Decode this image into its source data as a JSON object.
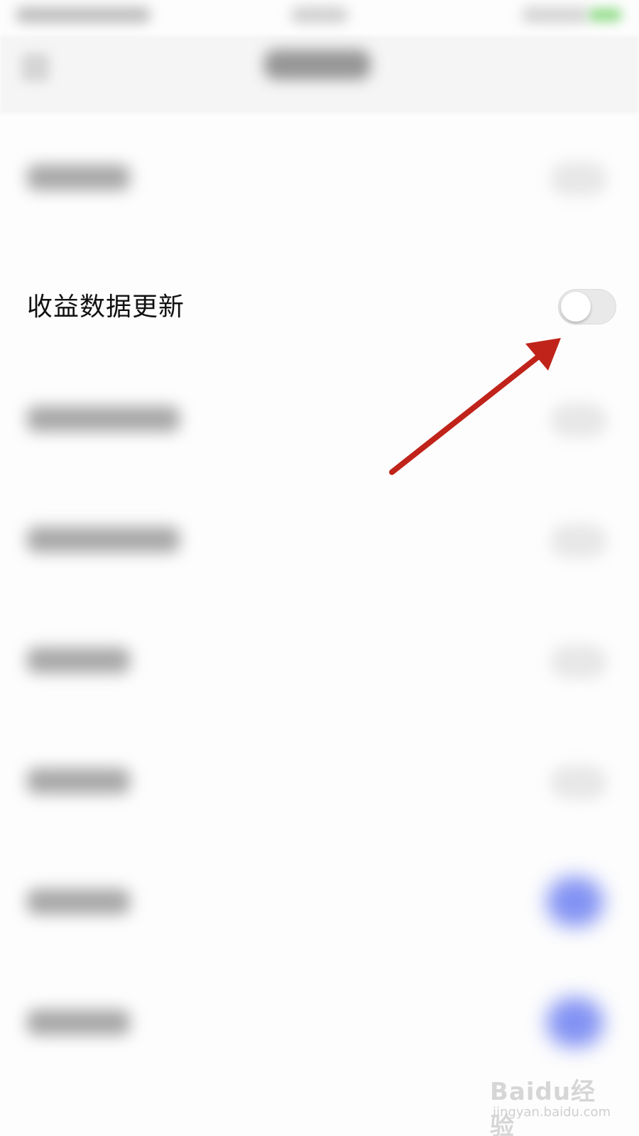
{
  "settings": {
    "focused_row": {
      "label": "收益数据更新",
      "toggle_state": "off"
    }
  },
  "colors": {
    "arrow": "#c0231a",
    "toggle_track_off": "#e9e9ea",
    "accent_blurred": "#5a6ff0"
  },
  "watermark": {
    "main": "Baidu经验",
    "sub": "jingyan.baidu.com"
  }
}
